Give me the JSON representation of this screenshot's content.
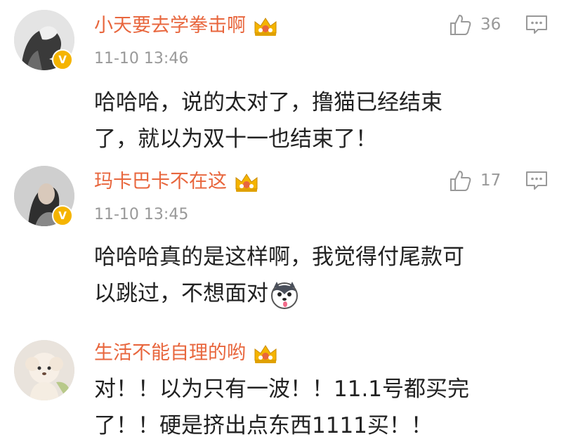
{
  "comments": [
    {
      "username": "小天要去学拳击啊",
      "timestamp": "11-10 13:46",
      "like_count": "36",
      "lines": [
        "哈哈哈，说的太对了，撸猫已经结束",
        "了，就以为双十一也结束了！"
      ],
      "verified": true
    },
    {
      "username": "玛卡巴卡不在这",
      "timestamp": "11-10 13:45",
      "like_count": "17",
      "lines": [
        "哈哈哈真的是这样啊，我觉得付尾款可",
        "以跳过，不想面对"
      ],
      "verified": true
    },
    {
      "username": "生活不能自理的哟",
      "lines": [
        "对！！以为只有一波！！11.1号都买完",
        "了！！硬是挤出点东西1111买！！"
      ]
    }
  ],
  "colors": {
    "username": "#e8663d",
    "timestamp": "#999999",
    "body": "#222222",
    "badge": "#f5b400"
  },
  "icons": {
    "like": "thumbs-up-icon",
    "reply": "comment-bubble-icon",
    "crown": "crown-member-icon",
    "verified": "verified-v-badge-icon"
  }
}
